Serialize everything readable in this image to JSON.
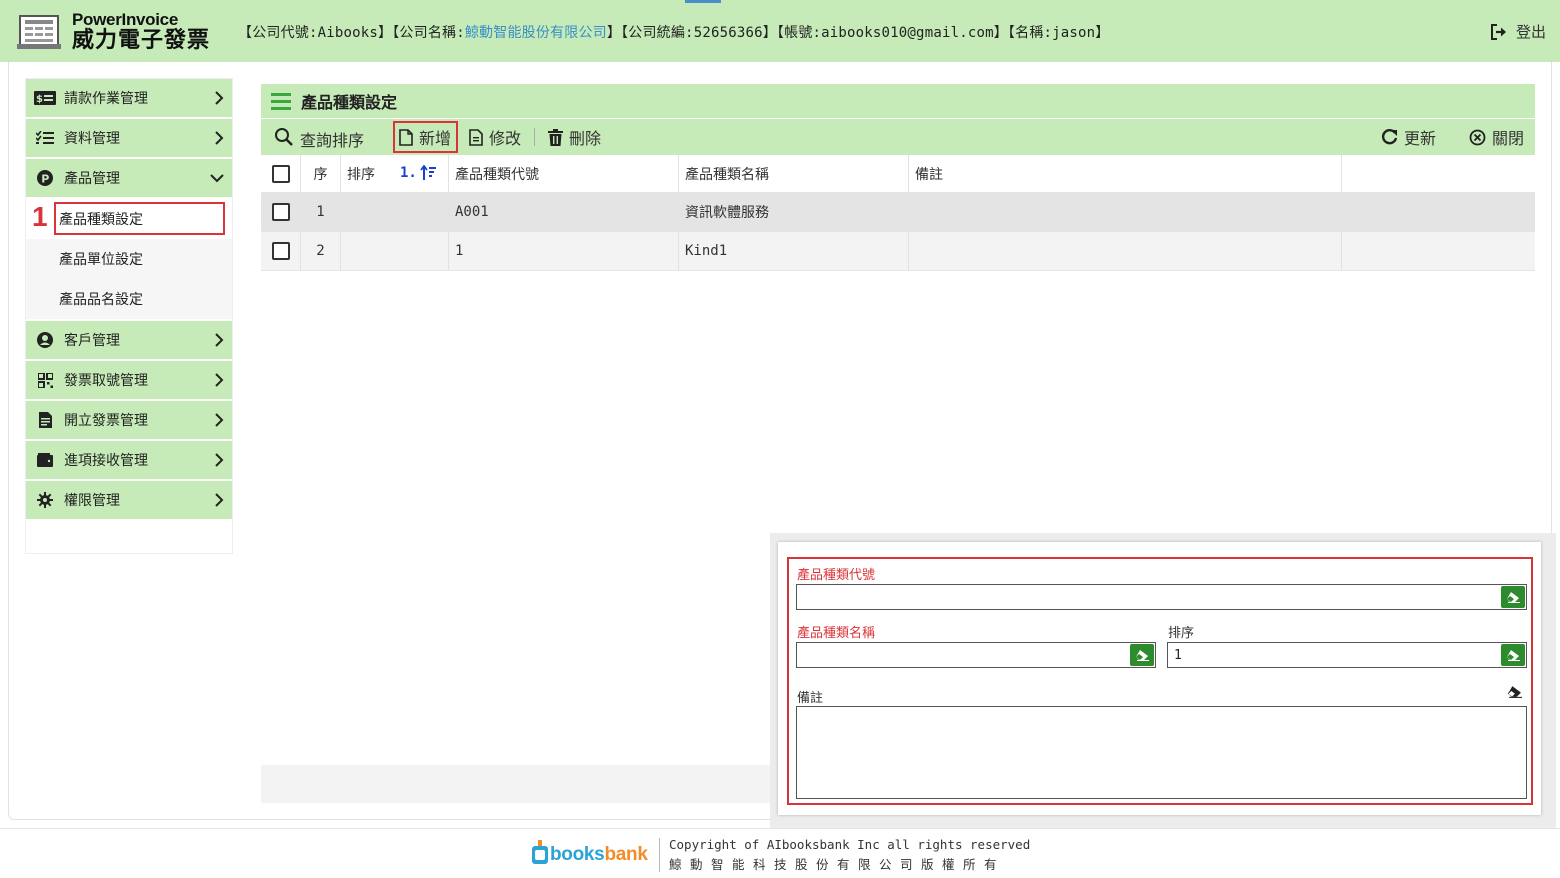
{
  "header": {
    "logo_en": "PowerInvoice",
    "logo_zh": "威力電子發票",
    "info_prefix": "【公司代號:Aibooks】【公司名稱:",
    "company_name": "鯨動智能股份有限公司",
    "info_suffix": "】【公司統編:52656366】【帳號:aibooks010@gmail.com】【名稱:jason】",
    "logout_label": "登出"
  },
  "sidebar": {
    "items": [
      {
        "label": "請款作業管理",
        "icon": "invoice-money-icon"
      },
      {
        "label": "資料管理",
        "icon": "list-check-icon"
      },
      {
        "label": "產品管理",
        "icon": "product-p-icon"
      },
      {
        "label": "客戶管理",
        "icon": "user-circle-icon"
      },
      {
        "label": "發票取號管理",
        "icon": "qrcode-icon"
      },
      {
        "label": "開立發票管理",
        "icon": "file-invoice-icon"
      },
      {
        "label": "進項接收管理",
        "icon": "wallet-icon"
      },
      {
        "label": "權限管理",
        "icon": "gear-icon"
      }
    ],
    "sub_items": [
      {
        "label": "產品種類設定"
      },
      {
        "label": "產品單位設定"
      },
      {
        "label": "產品品名設定"
      }
    ],
    "step_marker": "1"
  },
  "page": {
    "title": "產品種類設定"
  },
  "toolbar": {
    "query_sort": "查詢排序",
    "new": "新增",
    "edit": "修改",
    "delete": "刪除",
    "refresh": "更新",
    "close": "關閉"
  },
  "grid": {
    "headers": {
      "seq": "序",
      "order": "排序",
      "sort_indicator": "1.",
      "code": "產品種類代號",
      "name": "產品種類名稱",
      "note": "備註"
    },
    "rows": [
      {
        "seq": "1",
        "order": "",
        "code": "A001",
        "name": "資訊軟體服務",
        "note": ""
      },
      {
        "seq": "2",
        "order": "",
        "code": "1",
        "name": "Kind1",
        "note": ""
      }
    ]
  },
  "form": {
    "code_label": "產品種類代號",
    "code_value": "",
    "name_label": "產品種類名稱",
    "name_value": "",
    "order_label": "排序",
    "order_value": "1",
    "note_label": "備註",
    "note_value": ""
  },
  "footer": {
    "brand_prefix": "AI",
    "brand_books": "books",
    "brand_bank": "bank",
    "copyright": "Copyright of AIbooksbank Inc all rights reserved",
    "copyright_zh": "鯨動智能科技股份有限公司版權所有"
  },
  "colors": {
    "header_green": "#c6ebb8",
    "highlight_red": "#d9343a",
    "erase_button_green": "#2d8a2d",
    "link_blue": "#3a8fc6",
    "sort_blue": "#1a3fd4"
  }
}
